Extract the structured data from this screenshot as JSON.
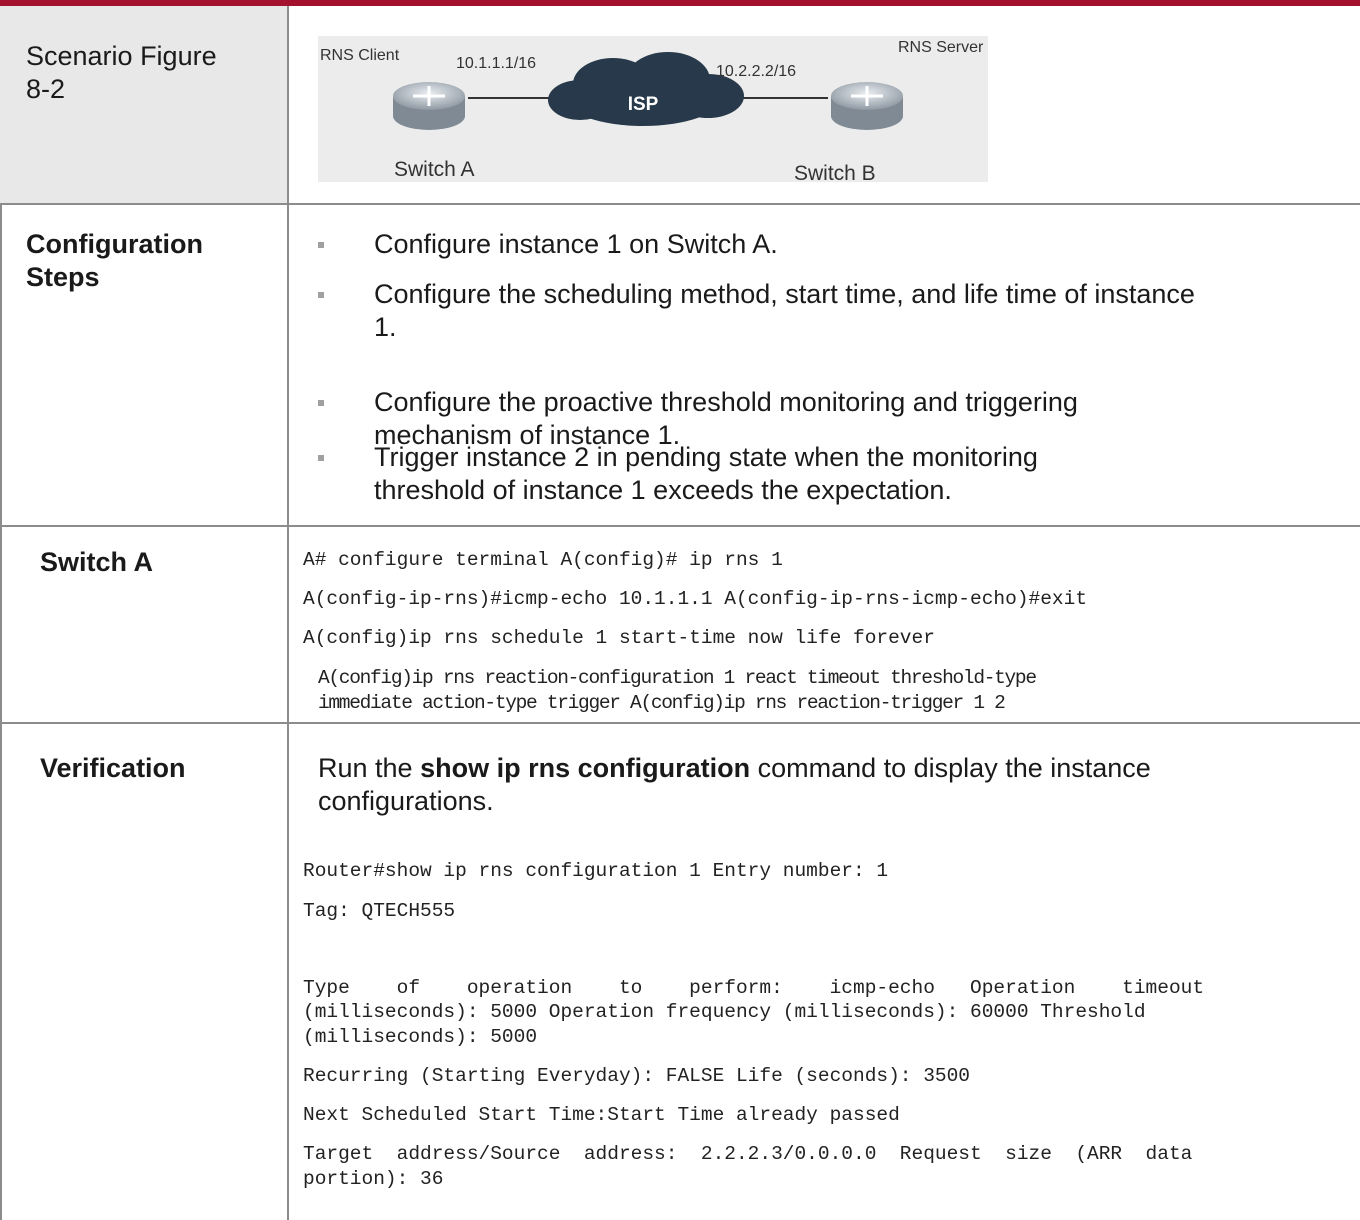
{
  "scenario": {
    "label": "Scenario Figure 8-2",
    "diagram": {
      "client_label": "RNS Client",
      "server_label": "RNS Server",
      "client_ip": "10.1.1.1/16",
      "server_ip": "10.2.2.2/16",
      "cloud_label": "ISP",
      "switch_a": "Switch A",
      "switch_b": "Switch B"
    }
  },
  "config_steps": {
    "label_line1": "Configuration",
    "label_line2": "Steps",
    "steps": [
      {
        "lines": [
          "Configure instance 1 on Switch A."
        ]
      },
      {
        "lines": [
          "Configure the scheduling method, start time, and life time of instance",
          "1."
        ]
      },
      {
        "lines": [
          "Configure the proactive threshold monitoring and triggering",
          "mechanism of instance 1."
        ]
      },
      {
        "lines": [
          "Trigger instance 2 in pending state when the monitoring",
          "threshold of instance 1 exceeds the expectation."
        ]
      }
    ]
  },
  "switch_a": {
    "label": "Switch A",
    "code": [
      "A# configure terminal A(config)# ip rns 1",
      "A(config-ip-rns)#icmp-echo 10.1.1.1 A(config-ip-rns-icmp-echo)#exit",
      "A(config)ip rns schedule 1 start-time now life forever",
      "A(config)ip rns reaction-configuration 1 react timeout threshold-type",
      "immediate action-type trigger A(config)ip rns reaction-trigger 1 2"
    ]
  },
  "verification": {
    "label": "Verification",
    "intro_prefix": "Run the ",
    "intro_command": "show ip rns configuration",
    "intro_suffix": " command to display the instance",
    "intro_line2": "configurations.",
    "output": [
      "Router#show ip rns configuration 1 Entry number: 1",
      "Tag: QTECH555",
      "Type    of    operation    to    perform:    icmp-echo   Operation    timeout",
      "(milliseconds): 5000 Operation frequency (milliseconds): 60000 Threshold",
      "(milliseconds): 5000",
      "Recurring (Starting Everyday): FALSE Life (seconds): 3500",
      "Next Scheduled Start Time:Start Time already passed",
      "Target  address/Source  address:  2.2.2.3/0.0.0.0  Request  size  (ARR  data",
      "portion): 36"
    ]
  }
}
